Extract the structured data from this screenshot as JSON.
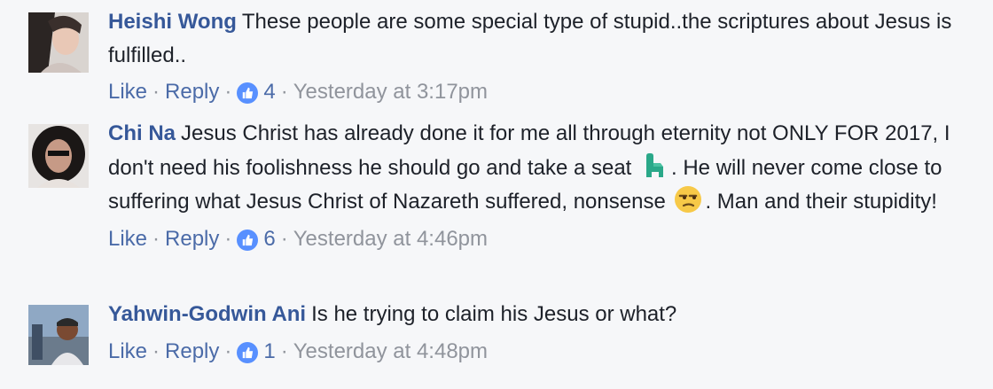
{
  "comments": [
    {
      "author": "Heishi Wong",
      "text": "These people are some special type of stupid..the scriptures about Jesus is fulfilled..",
      "like_label": "Like",
      "reply_label": "Reply",
      "reactions": "4",
      "time": "Yesterday at 3:17pm"
    },
    {
      "author": "Chi Na",
      "text_1": "Jesus Christ has already done it for me all through eternity not ONLY FOR 2017, I don't need his foolishness he should go and take a seat",
      "text_2": ". He will never come close to suffering what Jesus Christ of Nazareth suffered, nonsense",
      "text_3": ". Man and their stupidity!",
      "emoji_1": "seat-icon",
      "emoji_2": "unamused-face-icon",
      "like_label": "Like",
      "reply_label": "Reply",
      "reactions": "6",
      "time": "Yesterday at 4:46pm"
    },
    {
      "author": "Yahwin-Godwin Ani",
      "text": "Is he trying to claim his Jesus or what?",
      "like_label": "Like",
      "reply_label": "Reply",
      "reactions": "1",
      "time": "Yesterday at 4:48pm"
    }
  ],
  "colors": {
    "author": "#365899",
    "action": "#4b6ba8",
    "meta": "#90949c",
    "like_badge": "#5890ff",
    "background": "#f6f7f9"
  }
}
